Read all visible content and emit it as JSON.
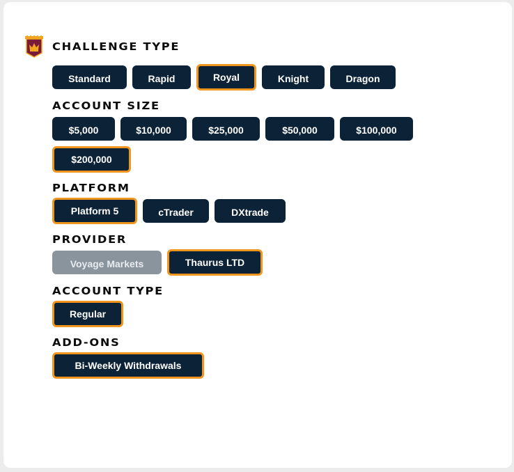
{
  "sections": [
    {
      "title": "CHALLENGE TYPE",
      "icon": "crown-banner-icon",
      "options": [
        {
          "label": "Standard",
          "state": "default"
        },
        {
          "label": "Rapid",
          "state": "default"
        },
        {
          "label": "Royal",
          "state": "selected"
        },
        {
          "label": "Knight",
          "state": "default"
        },
        {
          "label": "Dragon",
          "state": "default"
        }
      ]
    },
    {
      "title": "ACCOUNT SIZE",
      "options": [
        {
          "label": "$5,000",
          "state": "default"
        },
        {
          "label": "$10,000",
          "state": "default"
        },
        {
          "label": "$25,000",
          "state": "default"
        },
        {
          "label": "$50,000",
          "state": "default"
        },
        {
          "label": "$100,000",
          "state": "default"
        },
        {
          "label": "$200,000",
          "state": "selected"
        }
      ]
    },
    {
      "title": "PLATFORM",
      "options": [
        {
          "label": "Platform 5",
          "state": "selected"
        },
        {
          "label": "cTrader",
          "state": "default"
        },
        {
          "label": "DXtrade",
          "state": "default"
        }
      ]
    },
    {
      "title": "PROVIDER",
      "options": [
        {
          "label": "Voyage Markets",
          "state": "disabled"
        },
        {
          "label": "Thaurus LTD",
          "state": "selected"
        }
      ]
    },
    {
      "title": "ACCOUNT TYPE",
      "options": [
        {
          "label": "Regular",
          "state": "selected"
        }
      ]
    },
    {
      "title": "ADD-ONS",
      "options": [
        {
          "label": "Bi-Weekly Withdrawals",
          "state": "selected"
        }
      ]
    }
  ],
  "colors": {
    "button_bg": "#0c2236",
    "selected_border": "#f0951d",
    "disabled_bg": "#8a949c",
    "page_bg": "#ececec",
    "card_bg": "#ffffff",
    "crown_banner": "#7a1a3a",
    "crown_gold": "#f2a51e"
  }
}
